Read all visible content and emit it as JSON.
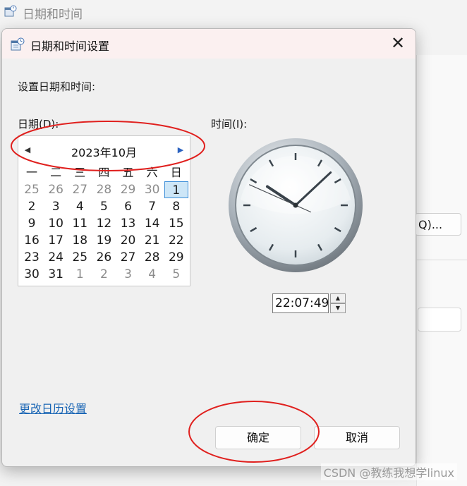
{
  "background_window": {
    "title": "日期和时间",
    "partial_button_label": "Q)..."
  },
  "dialog": {
    "title": "日期和时间设置",
    "instruction": "设置日期和时间:",
    "date_label": "日期(D):",
    "time_label": "时间(I):",
    "calendar": {
      "month_title": "2023年10月",
      "weekdays": [
        "一",
        "二",
        "三",
        "四",
        "五",
        "六",
        "日"
      ],
      "weeks": [
        [
          "25",
          "26",
          "27",
          "28",
          "29",
          "30",
          "1"
        ],
        [
          "2",
          "3",
          "4",
          "5",
          "6",
          "7",
          "8"
        ],
        [
          "9",
          "10",
          "11",
          "12",
          "13",
          "14",
          "15"
        ],
        [
          "16",
          "17",
          "18",
          "19",
          "20",
          "21",
          "22"
        ],
        [
          "23",
          "24",
          "25",
          "26",
          "27",
          "28",
          "29"
        ],
        [
          "30",
          "31",
          "1",
          "2",
          "3",
          "4",
          "5"
        ]
      ],
      "selected_day": "1"
    },
    "clock": {
      "hour": 22,
      "minute": 7,
      "second": 49
    },
    "time_value": "22:07:49",
    "change_calendar_link": "更改日历设置",
    "ok_label": "确定",
    "cancel_label": "取消"
  },
  "watermark": "CSDN @教练我想学linux",
  "colors": {
    "link": "#1764b4",
    "selected_day_bg": "#cde6f7",
    "selected_day_border": "#3d8ed8",
    "annotation": "#e0201e"
  }
}
